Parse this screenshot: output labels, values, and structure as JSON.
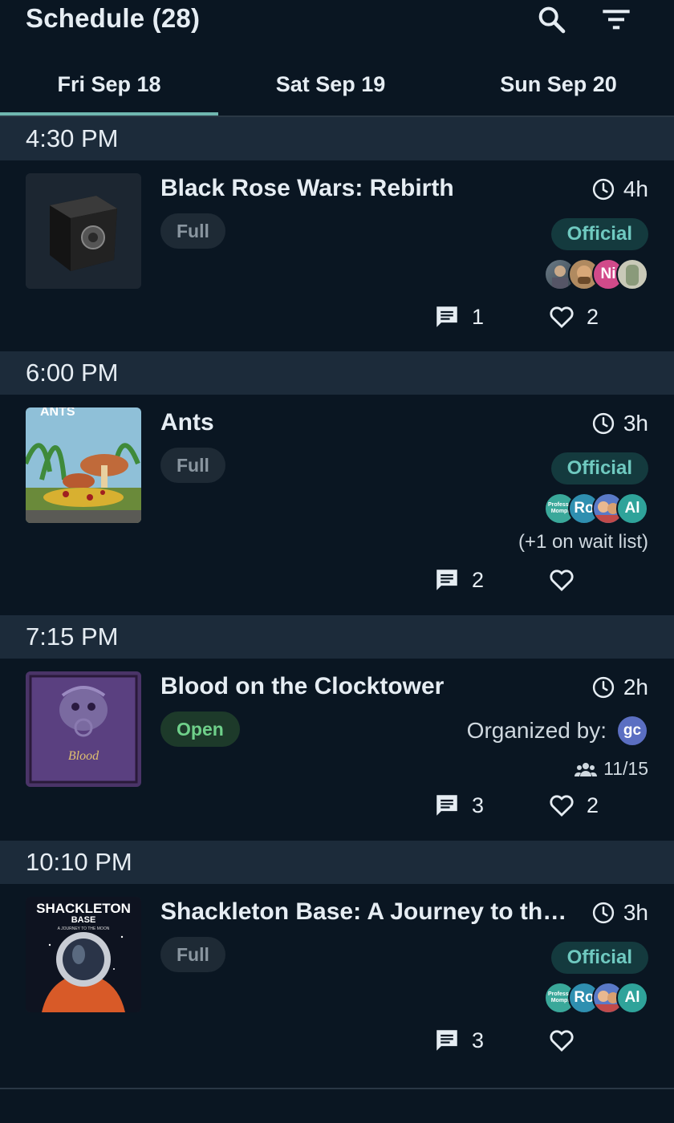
{
  "header": {
    "title": "Schedule (28)",
    "search_icon": "search-icon",
    "filter_icon": "filter-icon"
  },
  "tabs": [
    {
      "label": "Fri Sep 18",
      "selected": true
    },
    {
      "label": "Sat Sep 19",
      "selected": false
    },
    {
      "label": "Sun Sep 20",
      "selected": false
    }
  ],
  "colors": {
    "background": "#0a1622",
    "section": "#1c2b3a",
    "accent": "#6fb7b0",
    "official_text": "#6fc9c0",
    "open_text": "#6fd08a"
  },
  "sections": [
    {
      "time": "4:30 PM",
      "event": {
        "title": "Black Rose Wars: Rebirth",
        "duration": "4h",
        "status": "Full",
        "badge": "Official",
        "avatars": [
          "",
          "",
          "Ni",
          ""
        ],
        "comments": "1",
        "likes": "2"
      }
    },
    {
      "time": "6:00 PM",
      "event": {
        "title": "Ants",
        "duration": "3h",
        "status": "Full",
        "badge": "Official",
        "avatars": [
          "Professo Mompi",
          "Ro",
          "",
          "Al"
        ],
        "waitlist": "(+1 on wait list)",
        "comments": "2",
        "likes": ""
      }
    },
    {
      "time": "7:15 PM",
      "event": {
        "title": "Blood on the Clocktower",
        "duration": "2h",
        "status": "Open",
        "organized_label": "Organized by:",
        "organizer": "gc",
        "players": "11/15",
        "comments": "3",
        "likes": "2"
      }
    },
    {
      "time": "10:10 PM",
      "event": {
        "title": "Shackleton Base: A Journey to the Moon",
        "duration": "3h",
        "status": "Full",
        "badge": "Official",
        "avatars": [
          "Professo Mompi",
          "Ro",
          "",
          "Al"
        ],
        "comments": "3",
        "likes": "",
        "thumb_text": "SHACKLETON",
        "thumb_subtext": "BASE",
        "thumb_tagline": "A JOURNEY TO THE MOON"
      }
    }
  ]
}
